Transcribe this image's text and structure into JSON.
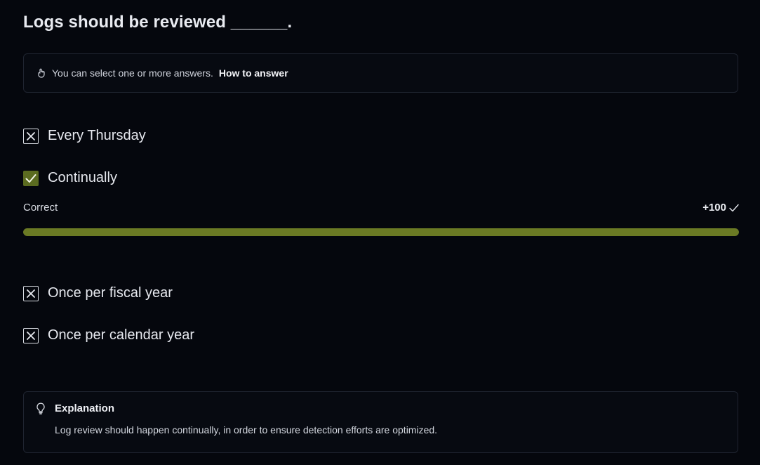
{
  "question": {
    "title": "Logs should be reviewed ______."
  },
  "hint": {
    "icon": "hand-pointer-icon",
    "text": "You can select one or more answers.",
    "link_label": "How to answer"
  },
  "options": [
    {
      "label": "Every Thursday",
      "state": "incorrect"
    },
    {
      "label": "Continually",
      "state": "correct"
    },
    {
      "label": "Once per fiscal year",
      "state": "incorrect"
    },
    {
      "label": "Once per calendar year",
      "state": "incorrect"
    }
  ],
  "result": {
    "label": "Correct",
    "score": "+100",
    "progress": 1.0
  },
  "explanation": {
    "icon": "lightbulb-icon",
    "title": "Explanation",
    "body": "Log review should happen continually, in order to ensure detection efforts are optimized."
  },
  "colors": {
    "background": "#05070d",
    "correct_green": "#6b7a24"
  }
}
